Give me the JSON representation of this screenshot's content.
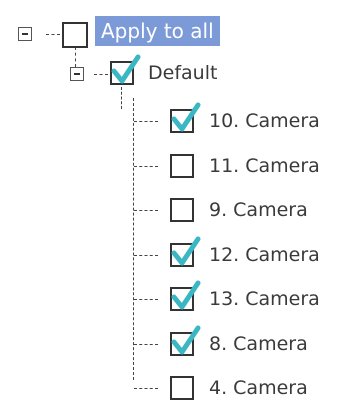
{
  "colors": {
    "accent_check": "#3bb7c4",
    "root_highlight": "#7c9ad8"
  },
  "tree": {
    "root": {
      "label": "Apply to all",
      "checked": false,
      "expanded": true
    },
    "group": {
      "label": "Default",
      "checked": true,
      "expanded": true
    },
    "cameras": [
      {
        "label": "10. Camera",
        "checked": true
      },
      {
        "label": "11. Camera",
        "checked": false
      },
      {
        "label": "9. Camera",
        "checked": false
      },
      {
        "label": "12. Camera",
        "checked": true
      },
      {
        "label": "13. Camera",
        "checked": true
      },
      {
        "label": "8. Camera",
        "checked": true
      },
      {
        "label": "4. Camera",
        "checked": false
      }
    ]
  }
}
